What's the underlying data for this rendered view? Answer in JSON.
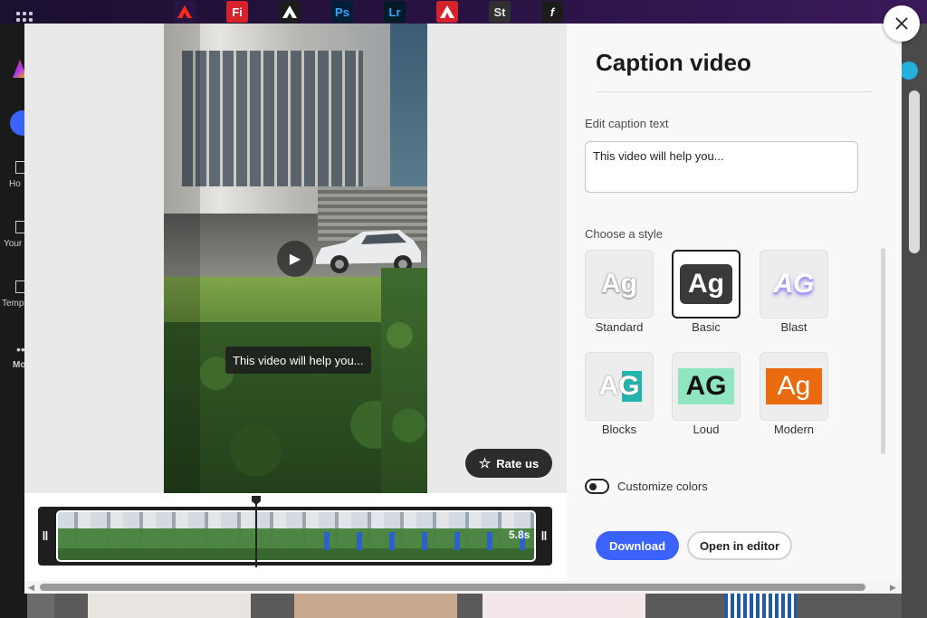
{
  "topbar": {
    "apps": [
      {
        "name": "adobe-express-icon",
        "label": "",
        "bg": "#2a1345",
        "color": "#ff2a1a"
      },
      {
        "name": "firefly-icon",
        "label": "Fi",
        "bg": "#d6232b",
        "color": "#ffffff"
      },
      {
        "name": "express-icon",
        "label": "",
        "bg": "#1c1c1c",
        "color": "#ffffff"
      },
      {
        "name": "photoshop-icon",
        "label": "Ps",
        "bg": "#001e36",
        "color": "#31a8ff"
      },
      {
        "name": "lightroom-icon",
        "label": "Lr",
        "bg": "#001a27",
        "color": "#31a8ff"
      },
      {
        "name": "acrobat-icon",
        "label": "",
        "bg": "#d6232b",
        "color": "#ffffff"
      },
      {
        "name": "stock-icon",
        "label": "St",
        "bg": "#2f2f2f",
        "color": "#e6e6e6"
      },
      {
        "name": "fonts-icon",
        "label": "f",
        "bg": "#1c1c1c",
        "color": "#ffffff"
      }
    ]
  },
  "background": {
    "rail": {
      "home_label": "Ho",
      "your_label": "Your",
      "templates_label": "Temp",
      "more_label": "Mo"
    }
  },
  "preview": {
    "caption_overlay": "This video will help you...",
    "rate_label": "Rate us",
    "duration": "5.8s"
  },
  "panel": {
    "title": "Caption video",
    "edit_label": "Edit caption text",
    "caption_value": "This video will help you...",
    "style_label": "Choose a style",
    "styles": [
      {
        "name": "Standard",
        "glyph": "Ag",
        "selected": false
      },
      {
        "name": "Basic",
        "glyph": "Ag",
        "selected": true
      },
      {
        "name": "Blast",
        "glyph": "AG",
        "selected": false
      },
      {
        "name": "Blocks",
        "glyph": "AG",
        "selected": false
      },
      {
        "name": "Loud",
        "glyph": "AG",
        "selected": false
      },
      {
        "name": "Modern",
        "glyph": "Ag",
        "selected": false
      }
    ],
    "customize_label": "Customize colors",
    "download_label": "Download",
    "editor_label": "Open in editor"
  },
  "colors": {
    "accent": "#3b63fb",
    "loud_bg": "#8fe6c0",
    "modern_bg": "#ea6a10"
  }
}
